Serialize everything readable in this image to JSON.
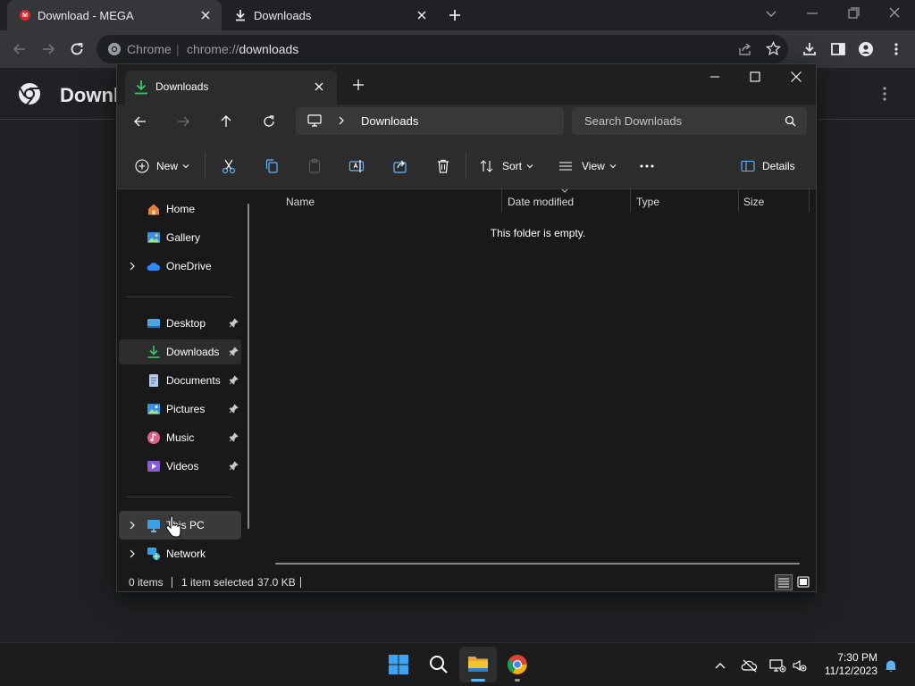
{
  "chrome": {
    "tabs": [
      {
        "title": "Download - MEGA",
        "favicon": "M"
      },
      {
        "title": "Downloads"
      }
    ],
    "omnibox": {
      "site_label": "Chrome",
      "separator": "|",
      "url_scheme": "chrome://",
      "url_host": "downloads"
    },
    "page_title": "Downloads"
  },
  "explorer": {
    "tab_title": "Downloads",
    "address": "Downloads",
    "search_placeholder": "Search Downloads",
    "commands": {
      "new": "New",
      "sort": "Sort",
      "view": "View",
      "details": "Details"
    },
    "nav_pane": {
      "items": [
        {
          "label": "Home"
        },
        {
          "label": "Gallery"
        },
        {
          "label": "OneDrive"
        },
        {
          "label": "Desktop"
        },
        {
          "label": "Downloads"
        },
        {
          "label": "Documents"
        },
        {
          "label": "Pictures"
        },
        {
          "label": "Music"
        },
        {
          "label": "Videos"
        },
        {
          "label": "This PC"
        },
        {
          "label": "Network"
        }
      ]
    },
    "columns": [
      "Name",
      "Date modified",
      "Type",
      "Size"
    ],
    "empty_message": "This folder is empty.",
    "status": {
      "items": "0 items",
      "selection": "1 item selected",
      "size": "37.0 KB"
    }
  },
  "taskbar": {
    "time": "7:30 PM",
    "date": "11/12/2023"
  },
  "colors": {
    "accent": "#0078d4",
    "download_green": "#3cc46b",
    "mega_red": "#d9272e",
    "folder_yellow": "#f4c430"
  }
}
